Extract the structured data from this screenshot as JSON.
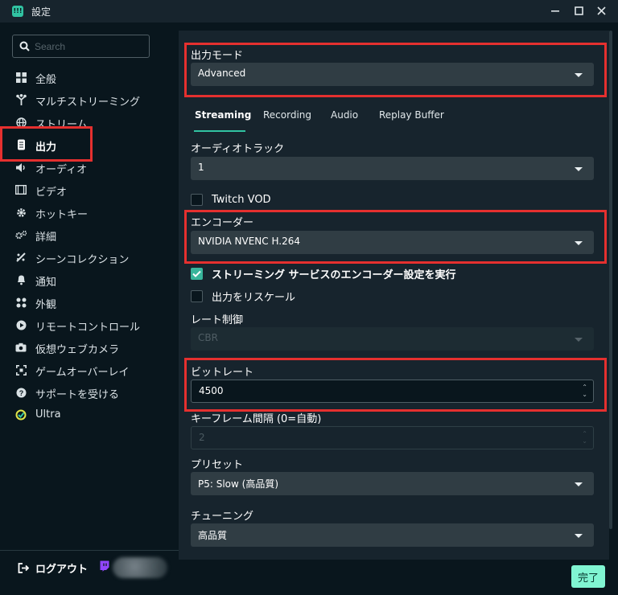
{
  "window": {
    "title": "設定",
    "app_icon_text": "!!!"
  },
  "sidebar": {
    "search_placeholder": "Search",
    "items": [
      {
        "label": "全般",
        "icon": "grid-icon"
      },
      {
        "label": "マルチストリーミング",
        "icon": "multistream-icon"
      },
      {
        "label": "ストリーム",
        "icon": "globe-icon"
      },
      {
        "label": "出力",
        "icon": "output-icon"
      },
      {
        "label": "オーディオ",
        "icon": "speaker-icon"
      },
      {
        "label": "ビデオ",
        "icon": "film-icon"
      },
      {
        "label": "ホットキー",
        "icon": "gear-icon"
      },
      {
        "label": "詳細",
        "icon": "gears-icon"
      },
      {
        "label": "シーンコレクション",
        "icon": "scenes-icon"
      },
      {
        "label": "通知",
        "icon": "bell-icon"
      },
      {
        "label": "外観",
        "icon": "grid-icon"
      },
      {
        "label": "リモートコントロール",
        "icon": "play-icon"
      },
      {
        "label": "仮想ウェブカメラ",
        "icon": "camera-icon"
      },
      {
        "label": "ゲームオーバーレイ",
        "icon": "overlay-icon"
      },
      {
        "label": "サポートを受ける",
        "icon": "help-icon"
      },
      {
        "label": "Ultra",
        "icon": "ultra-icon"
      }
    ],
    "active_item": "出力",
    "logout_label": "ログアウト"
  },
  "main": {
    "output_mode": {
      "label": "出力モード",
      "value": "Advanced"
    },
    "tabs": [
      "Streaming",
      "Recording",
      "Audio",
      "Replay Buffer"
    ],
    "active_tab": "Streaming",
    "audio_track": {
      "label": "オーディオトラック",
      "value": "1"
    },
    "twitch_vod": {
      "label": "Twitch VOD",
      "checked": false
    },
    "encoder": {
      "label": "エンコーダー",
      "value": "NVIDIA NVENC H.264"
    },
    "enforce_service": {
      "label": "ストリーミング サービスのエンコーダー設定を実行",
      "checked": true
    },
    "rescale": {
      "label": "出力をリスケール",
      "checked": false
    },
    "rate_control": {
      "label": "レート制御",
      "value": "CBR"
    },
    "bitrate": {
      "label": "ビットレート",
      "value": "4500"
    },
    "keyframe": {
      "label": "キーフレーム間隔 (0=自動)",
      "value": "2"
    },
    "preset": {
      "label": "プリセット",
      "value": "P5: Slow (高品質)"
    },
    "tuning": {
      "label": "チューニング",
      "value": "高品質"
    }
  },
  "footer": {
    "done_label": "完了"
  },
  "colors": {
    "accent": "#31c3a2",
    "highlight": "#e5302f",
    "done_button": "#80f5d2"
  }
}
